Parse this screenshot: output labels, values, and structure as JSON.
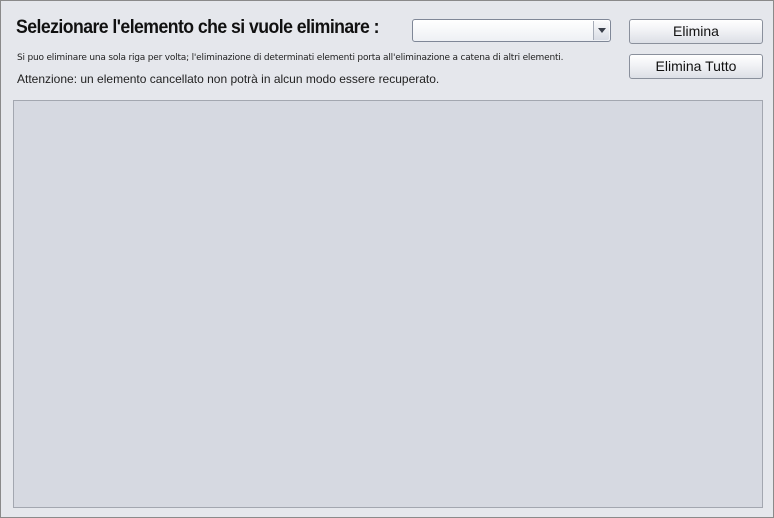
{
  "header": {
    "title": "Selezionare l'elemento che si vuole eliminare :",
    "note": "Si puo eliminare una sola riga per volta; l'eliminazione di determinati elementi porta all'eliminazione a catena di altri elementi.",
    "warning": "Attenzione: un elemento cancellato non potrà in alcun modo essere recuperato."
  },
  "element_select": {
    "selected_value": "",
    "icon": "chevron-down-icon"
  },
  "buttons": {
    "delete_label": "Elimina",
    "delete_all_label": "Elimina Tutto"
  },
  "colors": {
    "window_background": "#e5e7ec",
    "panel_background": "#d6d9e1"
  }
}
